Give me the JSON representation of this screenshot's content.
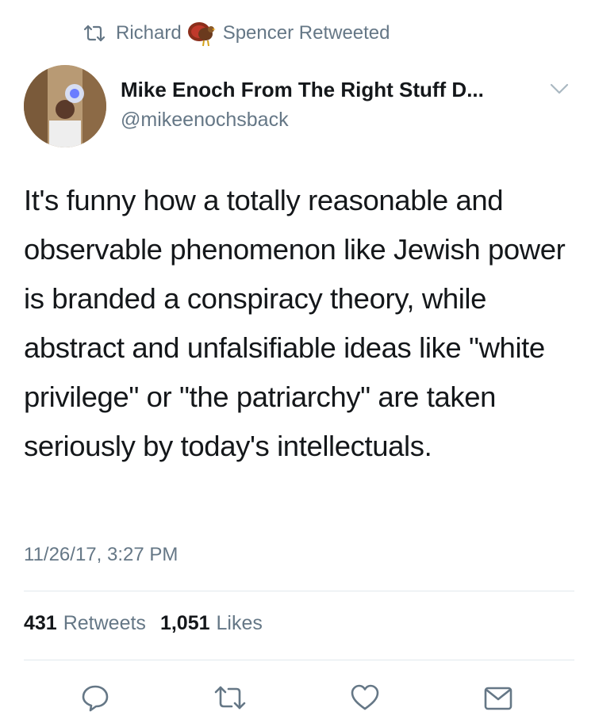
{
  "retweet_banner": {
    "name_first": "Richard",
    "name_last": "Spencer",
    "suffix": "Retweeted",
    "emoji_icon": "turkey-emoji-icon"
  },
  "author": {
    "display_name": "Mike Enoch From The Right Stuff D...",
    "handle": "@mikeenochsback"
  },
  "tweet": {
    "text": "It's funny how a totally reasonable and observable phenomenon like Jewish power is branded a conspiracy theory, while abstract and unfalsifiable ideas like \"white privilege\" or \"the patriarchy\" are taken seriously by today's intellectuals.",
    "timestamp": "11/26/17, 3:27 PM"
  },
  "stats": {
    "retweets_count": "431",
    "retweets_label": "Retweets",
    "likes_count": "1,051",
    "likes_label": "Likes"
  },
  "actions": [
    "reply-icon",
    "retweet-icon",
    "like-icon",
    "message-icon"
  ],
  "colors": {
    "text": "#14171a",
    "secondary": "#657786",
    "divider": "#e1e8ed",
    "action_icon": "#657786"
  }
}
